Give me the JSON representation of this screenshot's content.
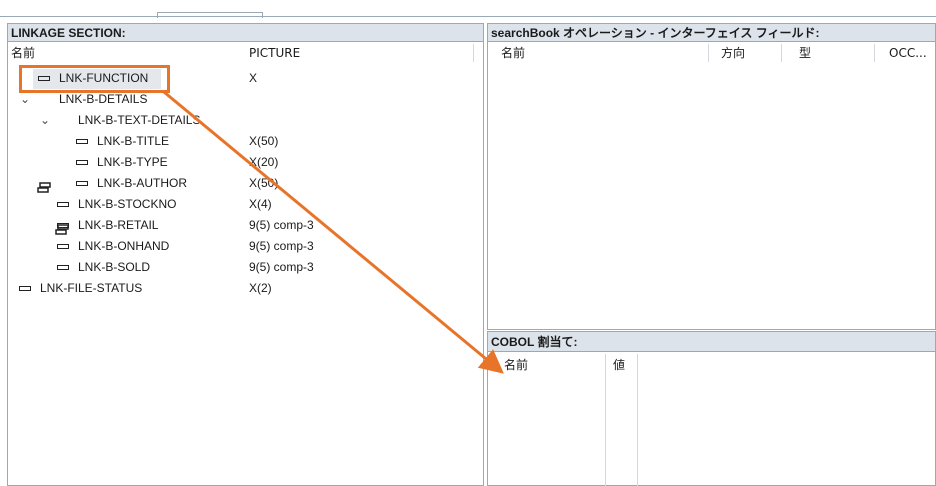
{
  "linkage": {
    "title": "LINKAGE SECTION:",
    "col_name": "名前",
    "col_picture": "PICTURE",
    "rows": [
      {
        "label": "LNK-FUNCTION",
        "picture": "X"
      },
      {
        "label": "LNK-B-DETAILS",
        "picture": ""
      },
      {
        "label": "LNK-B-TEXT-DETAILS",
        "picture": ""
      },
      {
        "label": "LNK-B-TITLE",
        "picture": "X(50)"
      },
      {
        "label": "LNK-B-TYPE",
        "picture": "X(20)"
      },
      {
        "label": "LNK-B-AUTHOR",
        "picture": "X(50)"
      },
      {
        "label": "LNK-B-STOCKNO",
        "picture": "X(4)"
      },
      {
        "label": "LNK-B-RETAIL",
        "picture": "9(5) comp-3"
      },
      {
        "label": "LNK-B-ONHAND",
        "picture": "9(5) comp-3"
      },
      {
        "label": "LNK-B-SOLD",
        "picture": "9(5) comp-3"
      },
      {
        "label": "LNK-FILE-STATUS",
        "picture": "X(2)"
      }
    ]
  },
  "interface": {
    "title": "searchBook オペレーション - インターフェイス フィールド:",
    "col_name": "名前",
    "col_direction": "方向",
    "col_type": "型",
    "col_occ": "OCC..."
  },
  "cobol": {
    "title": "COBOL 割当て:",
    "col_name": "名前",
    "col_value": "値"
  },
  "annotation": {
    "accent": "#e8742a"
  },
  "icons": {
    "field": "field-icon",
    "group": "group-icon",
    "expand": "chevron-down-icon"
  }
}
